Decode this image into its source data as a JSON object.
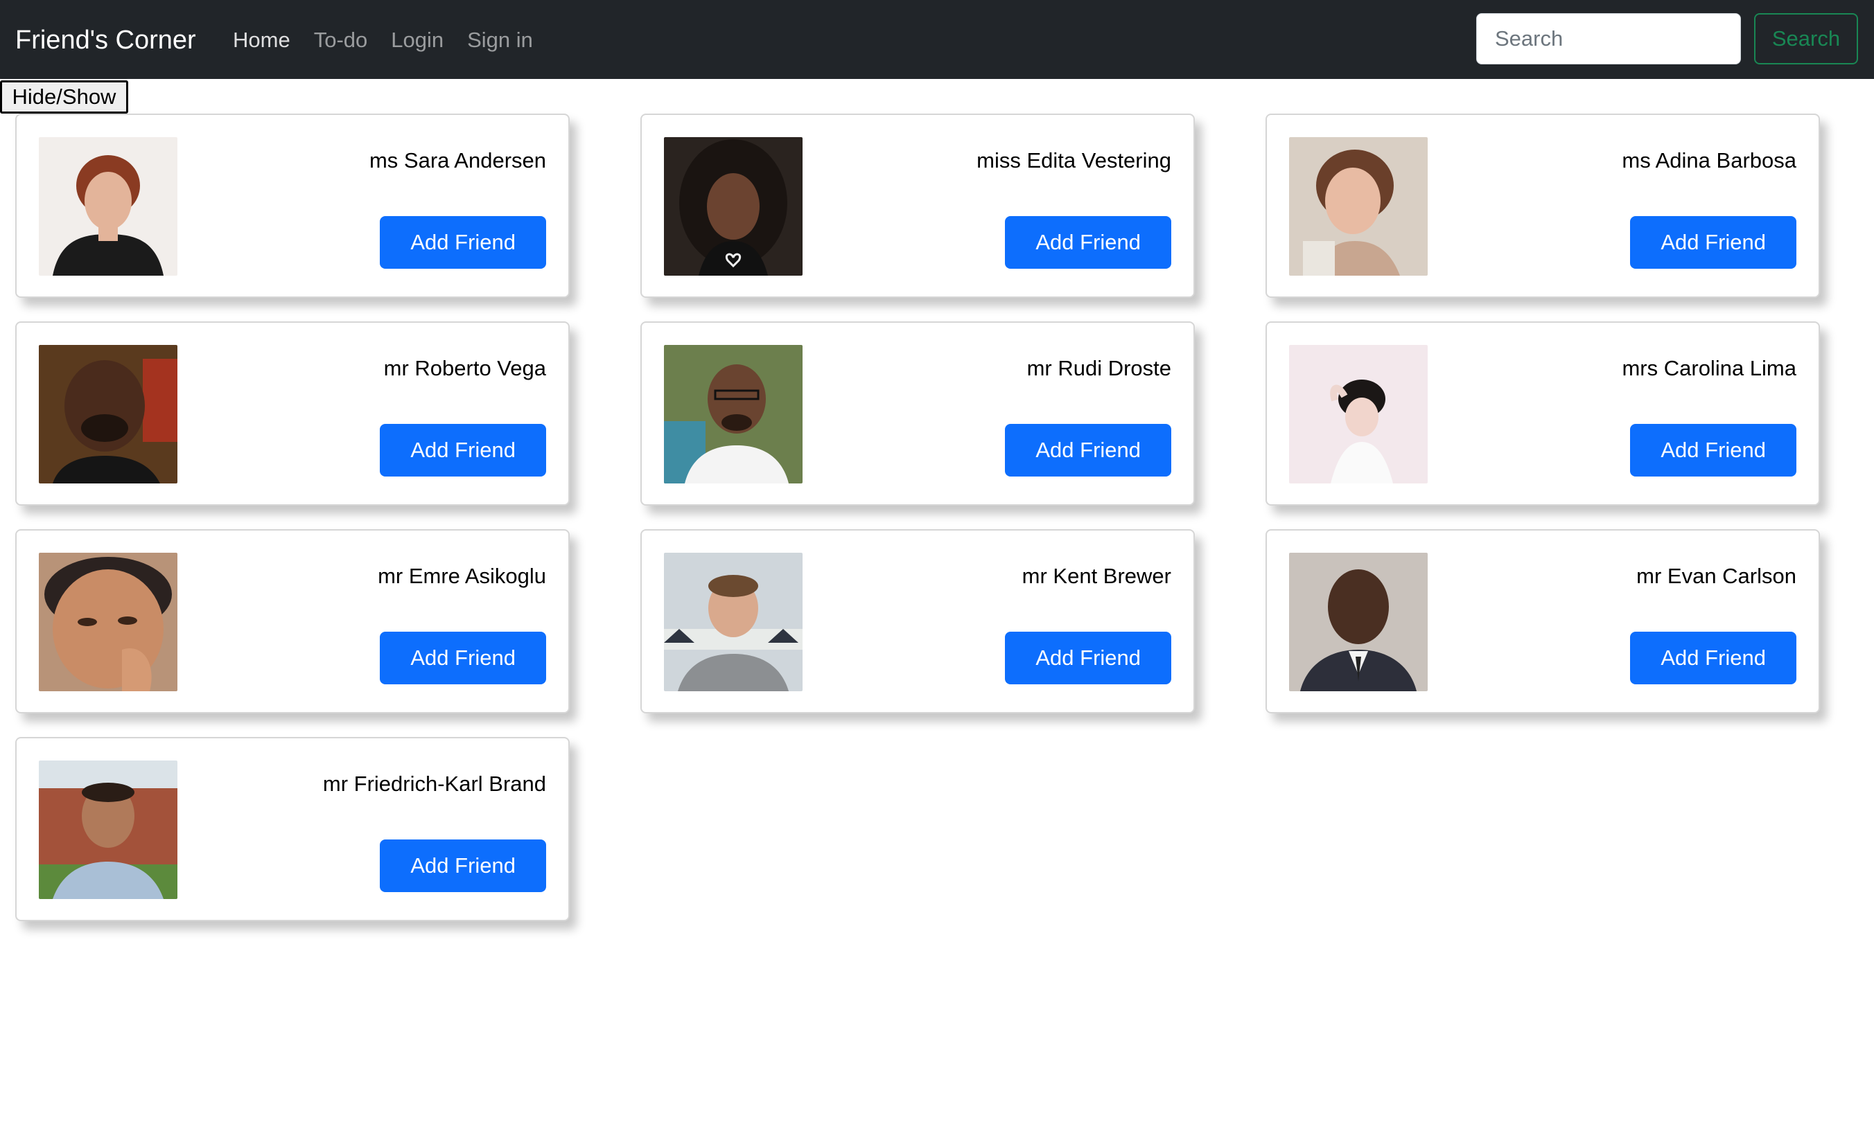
{
  "navbar": {
    "brand": "Friend's Corner",
    "links": [
      "Home",
      "To-do",
      "Login",
      "Sign in"
    ],
    "search_placeholder": "Search",
    "search_button": "Search"
  },
  "toggle_label": "Hide/Show",
  "colors": {
    "navbar_bg": "#212529",
    "primary": "#0d6efd",
    "success": "#198754"
  },
  "friends": [
    {
      "name": "ms Sara Andersen",
      "button": "Add Friend",
      "photo": "portrait-photo"
    },
    {
      "name": "miss Edita Vestering",
      "button": "Add Friend",
      "photo": "portrait-photo"
    },
    {
      "name": "ms Adina Barbosa",
      "button": "Add Friend",
      "photo": "portrait-photo"
    },
    {
      "name": "mr Roberto Vega",
      "button": "Add Friend",
      "photo": "portrait-photo"
    },
    {
      "name": "mr Rudi Droste",
      "button": "Add Friend",
      "photo": "portrait-photo"
    },
    {
      "name": "mrs Carolina Lima",
      "button": "Add Friend",
      "photo": "portrait-photo"
    },
    {
      "name": "mr Emre Asikoglu",
      "button": "Add Friend",
      "photo": "portrait-photo"
    },
    {
      "name": "mr Kent Brewer",
      "button": "Add Friend",
      "photo": "portrait-photo"
    },
    {
      "name": "mr Evan Carlson",
      "button": "Add Friend",
      "photo": "portrait-photo"
    },
    {
      "name": "mr Friedrich-Karl Brand",
      "button": "Add Friend",
      "photo": "portrait-photo"
    }
  ]
}
